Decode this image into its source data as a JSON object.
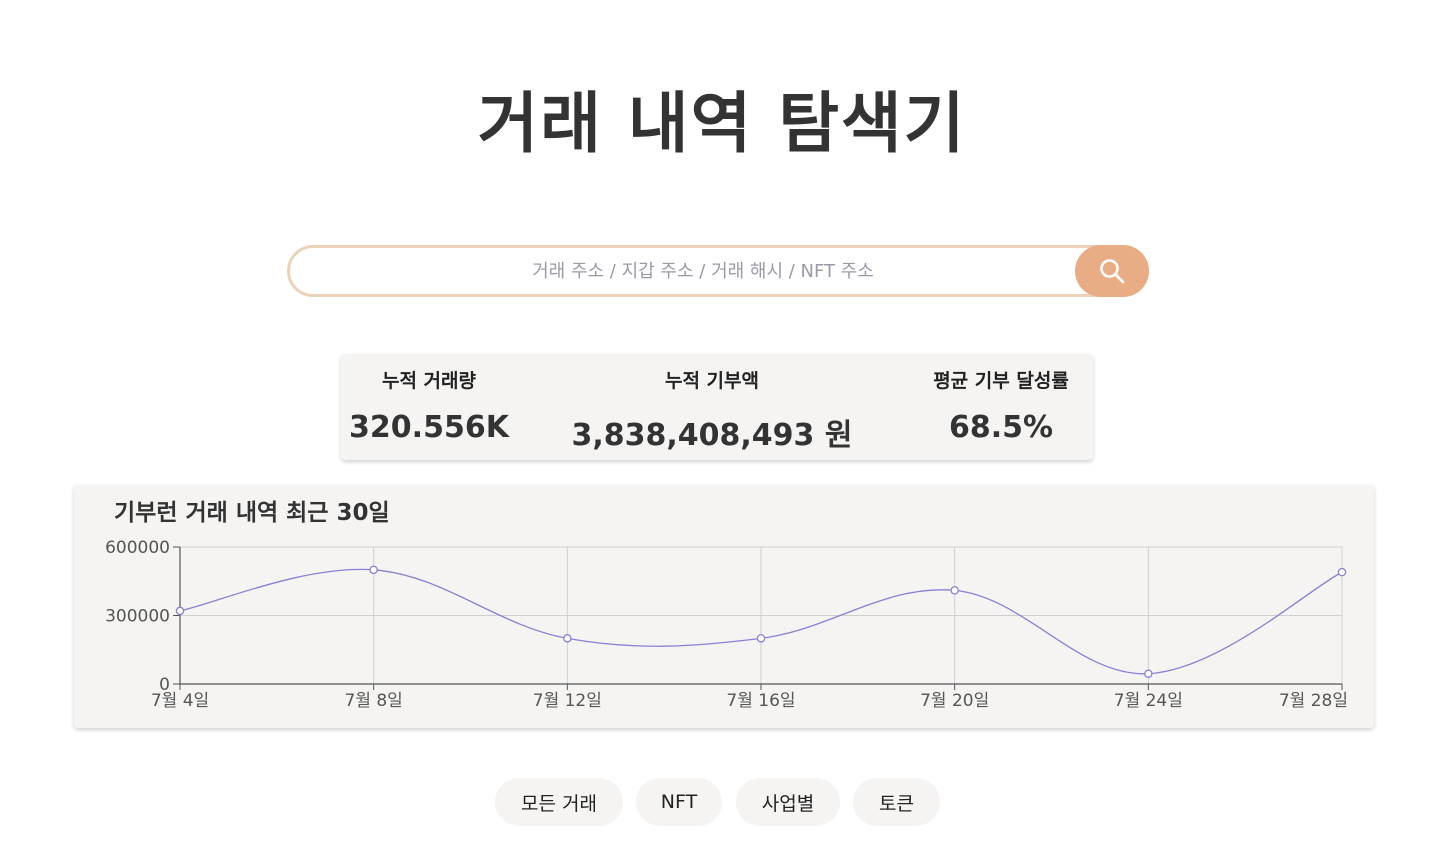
{
  "header": {
    "title": "거래 내역 탐색기"
  },
  "search": {
    "placeholder": "거래 주소 / 지갑 주소 / 거래 해시 / NFT 주소",
    "value": "",
    "button_icon": "search-icon",
    "accent_color": "#e9ad85",
    "border_color": "#ecd2b8"
  },
  "stats": [
    {
      "label": "누적 거래량",
      "value": "320.556K"
    },
    {
      "label": "누적 기부액",
      "value": "3,838,408,493 원"
    },
    {
      "label": "평균 기부 달성률",
      "value": "68.5%"
    }
  ],
  "chart": {
    "title": "기부런 거래 내역 최근 30일"
  },
  "chart_data": {
    "type": "line",
    "title": "기부런 거래 내역 최근 30일",
    "xlabel": "",
    "ylabel": "",
    "x": [
      "7월 4일",
      "7월 8일",
      "7월 12일",
      "7월 16일",
      "7월 20일",
      "7월 24일",
      "7월 28일"
    ],
    "series": [
      {
        "values": [
          320000,
          500000,
          200000,
          200000,
          410000,
          45000,
          490000
        ],
        "color": "#8a7fd4"
      }
    ],
    "yticks": [
      {
        "value": 0,
        "label": "0"
      },
      {
        "value": 300000,
        "label": "300000"
      },
      {
        "value": 600000,
        "label": "600000"
      }
    ],
    "ylim": [
      0,
      600000
    ],
    "grid": true,
    "smooth": true
  },
  "filters": [
    {
      "label": "모든 거래"
    },
    {
      "label": "NFT"
    },
    {
      "label": "사업별"
    },
    {
      "label": "토큰"
    }
  ]
}
